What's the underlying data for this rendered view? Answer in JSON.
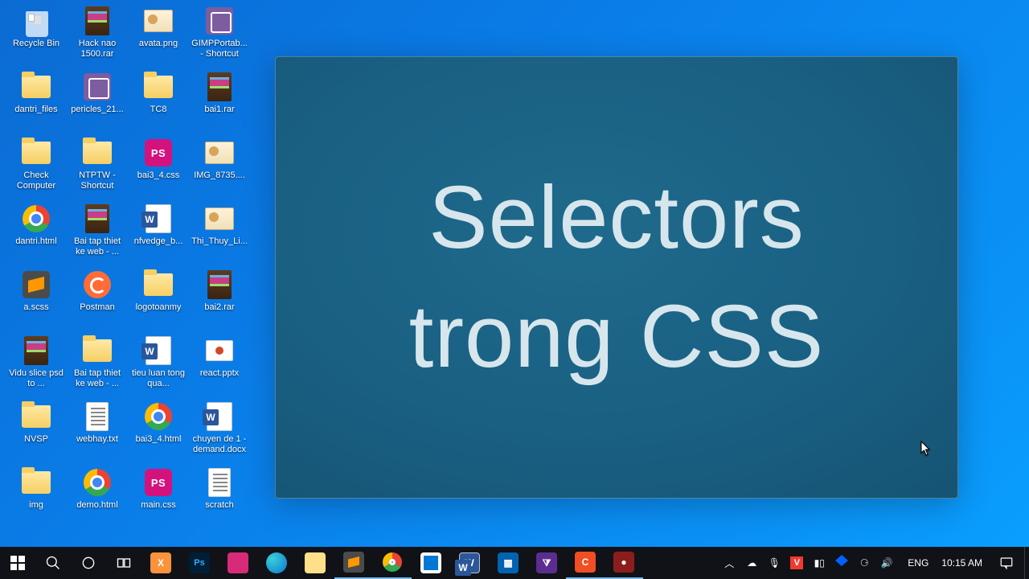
{
  "overlay": {
    "line1": "Selectors",
    "line2": "trong CSS"
  },
  "desktop_icons": [
    {
      "label": "Recycle Bin",
      "kind": "bin"
    },
    {
      "label": "Hack nao 1500.rar",
      "kind": "rar"
    },
    {
      "label": "avata.png",
      "kind": "img"
    },
    {
      "label": "GIMPPortab... - Shortcut",
      "kind": "exe"
    },
    {
      "label": "dantri_files",
      "kind": "folder"
    },
    {
      "label": "pericles_21...",
      "kind": "exe"
    },
    {
      "label": "TC8",
      "kind": "folder"
    },
    {
      "label": "bai1.rar",
      "kind": "rar"
    },
    {
      "label": "Check Computer",
      "kind": "folder"
    },
    {
      "label": "NTPTW - Shortcut",
      "kind": "folder"
    },
    {
      "label": "bai3_4.css",
      "kind": "ps"
    },
    {
      "label": "IMG_8735....",
      "kind": "img"
    },
    {
      "label": "dantri.html",
      "kind": "chrome"
    },
    {
      "label": "Bai tap thiet ke web - ...",
      "kind": "rar"
    },
    {
      "label": "nfvedge_b...",
      "kind": "word"
    },
    {
      "label": "Thi_Thuy_Li...",
      "kind": "img"
    },
    {
      "label": "a.scss",
      "kind": "sublime"
    },
    {
      "label": "Postman",
      "kind": "postman"
    },
    {
      "label": "logotoanmy",
      "kind": "folder"
    },
    {
      "label": "bai2.rar",
      "kind": "rar"
    },
    {
      "label": "Vidu slice psd to ...",
      "kind": "rar"
    },
    {
      "label": "Bai tap thiet ke web - ...",
      "kind": "folder"
    },
    {
      "label": "tieu luan tong qua...",
      "kind": "word"
    },
    {
      "label": "react.pptx",
      "kind": "ppt"
    },
    {
      "label": "NVSP",
      "kind": "folder"
    },
    {
      "label": "webhay.txt",
      "kind": "txt"
    },
    {
      "label": "bai3_4.html",
      "kind": "chrome"
    },
    {
      "label": "chuyen de 1 - demand.docx",
      "kind": "word"
    },
    {
      "label": "img",
      "kind": "folder"
    },
    {
      "label": "demo.html",
      "kind": "chrome"
    },
    {
      "label": "main.css",
      "kind": "ps"
    },
    {
      "label": "scratch",
      "kind": "txt"
    }
  ],
  "taskbar": {
    "pinned": [
      {
        "name": "xampp",
        "cls": "xampp",
        "text": "X"
      },
      {
        "name": "photoshop",
        "cls": "psd",
        "text": "Ps"
      },
      {
        "name": "wamp",
        "cls": "wamp",
        "text": ""
      },
      {
        "name": "edge",
        "cls": "edge",
        "text": ""
      },
      {
        "name": "file-explorer",
        "cls": "expl",
        "text": ""
      },
      {
        "name": "sublime-text",
        "cls": "subl",
        "text": "",
        "active": true
      },
      {
        "name": "chrome",
        "cls": "chrome",
        "text": "",
        "active": true
      },
      {
        "name": "microsoft-store",
        "cls": "store",
        "text": ""
      },
      {
        "name": "word",
        "cls": "word",
        "text": "W"
      },
      {
        "name": "calendar",
        "cls": "cal",
        "text": "▦"
      },
      {
        "name": "visual-studio",
        "cls": "vs",
        "text": "⧩"
      },
      {
        "name": "camtasia",
        "cls": "cam",
        "text": "C",
        "active": true
      },
      {
        "name": "recorder",
        "cls": "rec",
        "text": "●",
        "active": true
      }
    ],
    "language": "ENG",
    "time": "10:15 AM"
  }
}
